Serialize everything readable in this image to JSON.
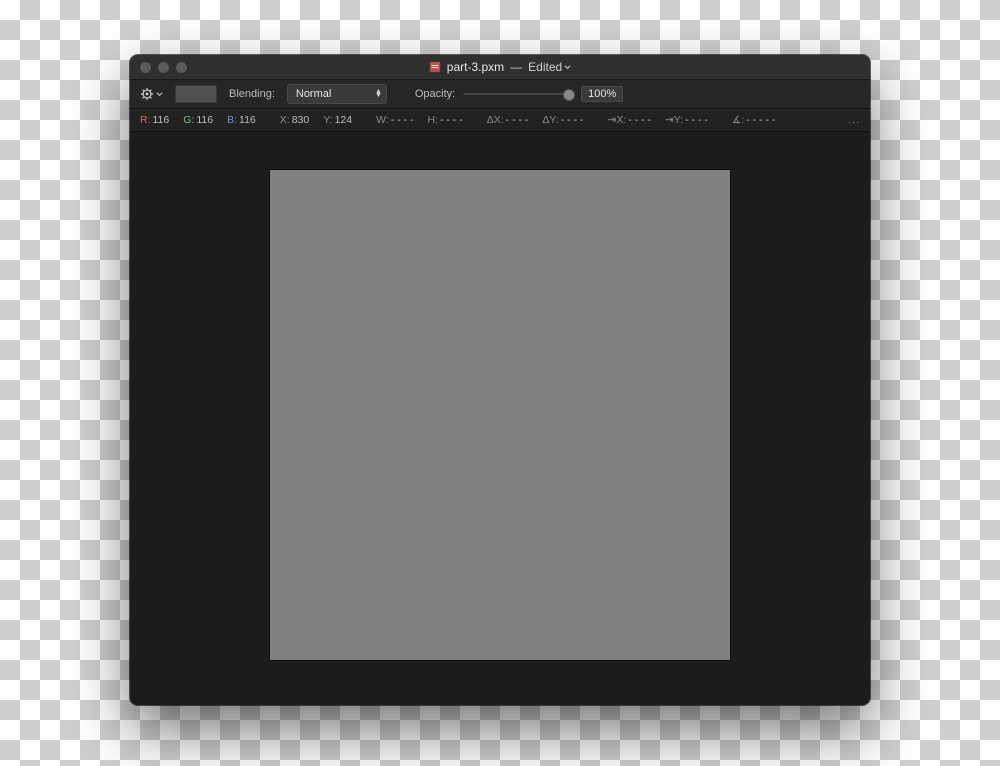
{
  "title": {
    "filename": "part-3.pxm",
    "separator": "—",
    "status": "Edited"
  },
  "toolbar": {
    "blending_label": "Blending:",
    "blending_value": "Normal",
    "opacity_label": "Opacity:",
    "opacity_value": "100%"
  },
  "info": {
    "r_label": "R:",
    "r_value": "116",
    "g_label": "G:",
    "g_value": "116",
    "b_label": "B:",
    "b_value": "116",
    "x_label": "X:",
    "x_value": "830",
    "y_label": "Y:",
    "y_value": "124",
    "w_label": "W:",
    "w_value": "- - - -",
    "h_label": "H:",
    "h_value": "- - - -",
    "dx_label": "ΔX:",
    "dx_value": "- - - -",
    "dy_label": "ΔY:",
    "dy_value": "- - - -",
    "ax_label": "⇥X:",
    "ax_value": "- - - -",
    "ay_label": "⇥Y:",
    "ay_value": "- - - -",
    "angle_label": "∡:",
    "angle_value": "- - - - -",
    "overflow": "..."
  },
  "canvas": {
    "fill_color": "#808080"
  }
}
